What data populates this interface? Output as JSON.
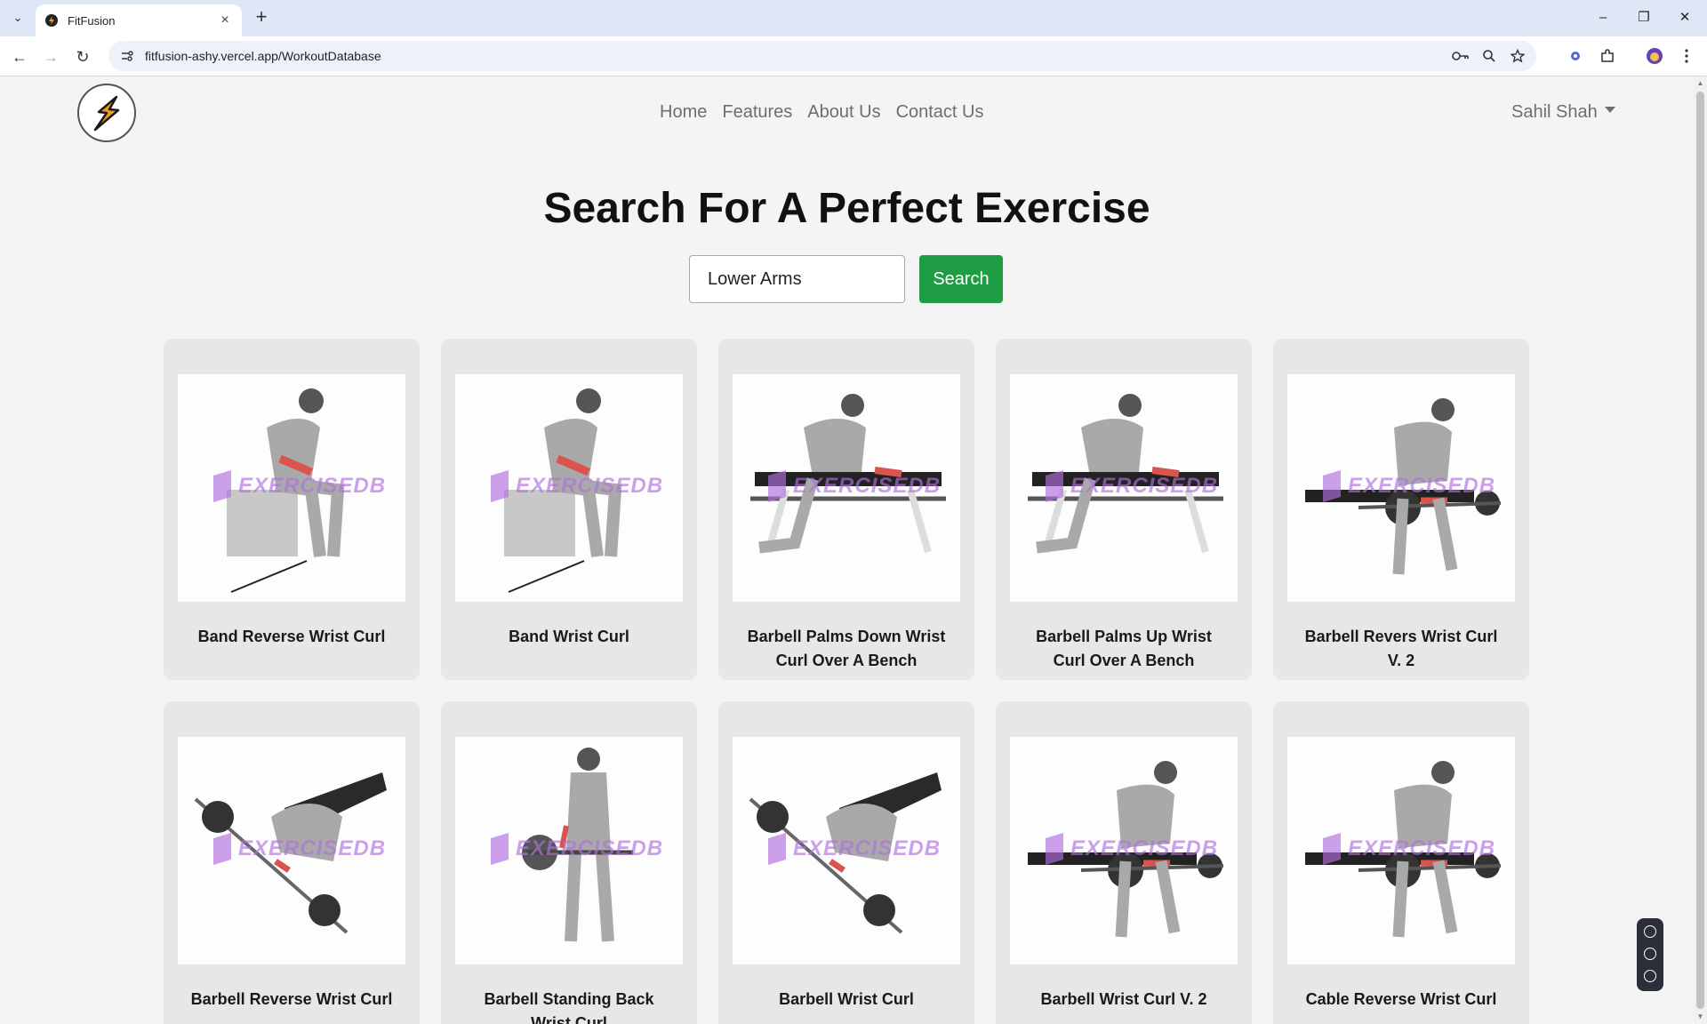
{
  "browser": {
    "tab_title": "FitFusion",
    "url": "fitfusion-ashy.vercel.app/WorkoutDatabase"
  },
  "nav": {
    "links": [
      "Home",
      "Features",
      "About Us",
      "Contact Us"
    ],
    "user_name": "Sahil Shah"
  },
  "page": {
    "title": "Search For A Perfect Exercise"
  },
  "search": {
    "value": "Lower Arms",
    "button_label": "Search"
  },
  "exercises": [
    {
      "name": "Band Reverse Wrist Curl"
    },
    {
      "name": "Band Wrist Curl"
    },
    {
      "name": "Barbell Palms Down Wrist Curl Over A Bench"
    },
    {
      "name": "Barbell Palms Up Wrist Curl Over A Bench"
    },
    {
      "name": "Barbell Revers Wrist Curl V. 2"
    },
    {
      "name": "Barbell Reverse Wrist Curl"
    },
    {
      "name": "Barbell Standing Back Wrist Curl"
    },
    {
      "name": "Barbell Wrist Curl"
    },
    {
      "name": "Barbell Wrist Curl V. 2"
    },
    {
      "name": "Cable Reverse Wrist Curl"
    }
  ],
  "watermark_text": "EXERCISEDB",
  "colors": {
    "search_button": "#1f9d45",
    "card_bg": "#e7e7ea",
    "highlight_muscle": "#d9534f",
    "watermark": "#b36ee0"
  }
}
